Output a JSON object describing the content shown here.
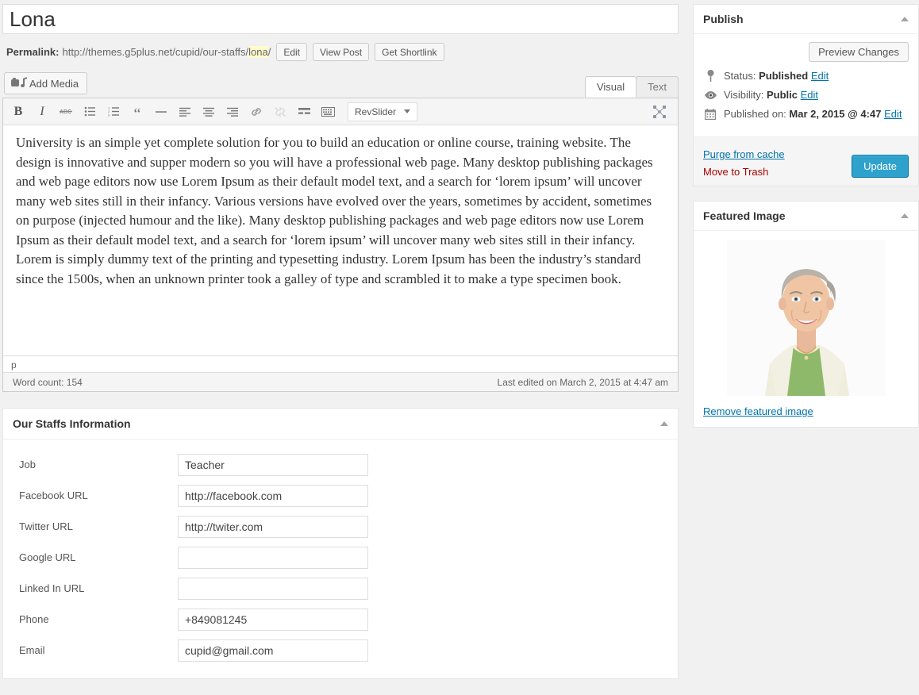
{
  "post": {
    "title": "Lona",
    "title_placeholder": "Enter title here"
  },
  "permalink": {
    "label": "Permalink:",
    "base_url": "http://themes.g5plus.net/cupid/our-staffs/",
    "slug": "lona",
    "trailing": "/",
    "edit_button": "Edit",
    "view_post_button": "View Post",
    "shortlink_button": "Get Shortlink"
  },
  "editor": {
    "add_media_label": "Add Media",
    "tabs": [
      {
        "label": "Visual",
        "active": true
      },
      {
        "label": "Text",
        "active": false
      }
    ],
    "toolbar": [
      {
        "name": "bold-icon",
        "label": "B"
      },
      {
        "name": "italic-icon",
        "label": "I"
      },
      {
        "name": "strikethrough-icon",
        "label": "ABC"
      },
      {
        "name": "bullet-list-icon",
        "label": ""
      },
      {
        "name": "numbered-list-icon",
        "label": ""
      },
      {
        "name": "blockquote-icon",
        "label": "“"
      },
      {
        "name": "horizontal-rule-icon",
        "label": ""
      },
      {
        "name": "align-left-icon",
        "label": ""
      },
      {
        "name": "align-center-icon",
        "label": ""
      },
      {
        "name": "align-right-icon",
        "label": ""
      },
      {
        "name": "insert-link-icon",
        "label": ""
      },
      {
        "name": "unlink-icon",
        "label": ""
      },
      {
        "name": "insert-more-tag-icon",
        "label": ""
      },
      {
        "name": "toolbar-toggle-icon",
        "label": ""
      }
    ],
    "revslider_label": "RevSlider",
    "content": "University is an simple yet complete solution for you to build an education or online course, training website. The design is innovative and supper modern so you will have a professional web page. Many desktop publishing packages and web page editors now use Lorem Ipsum as their default model text, and a search for ‘lorem ipsum’ will uncover many web sites still in their infancy. Various versions have evolved over the years, sometimes by accident, sometimes on purpose (injected humour and the like). Many desktop publishing packages and web page editors now use Lorem Ipsum as their default model text, and a search for ‘lorem ipsum’ will uncover many web sites still in their infancy. Lorem is simply dummy text of the printing and typesetting industry. Lorem Ipsum has been the industry’s standard since the 1500s, when an unknown printer took a galley of type and scrambled it to make a type specimen book.",
    "path": "p",
    "word_count": "Word count: 154",
    "last_edited": "Last edited on March 2, 2015 at 4:47 am"
  },
  "staffs_metabox": {
    "title": "Our Staffs Information",
    "fields": [
      {
        "label": "Job",
        "value": "Teacher",
        "name": "job-field"
      },
      {
        "label": "Facebook URL",
        "value": "http://facebook.com",
        "name": "facebook-url-field"
      },
      {
        "label": "Twitter URL",
        "value": "http://twiter.com",
        "name": "twitter-url-field"
      },
      {
        "label": "Google URL",
        "value": "",
        "name": "google-url-field"
      },
      {
        "label": "Linked In URL",
        "value": "",
        "name": "linkedin-url-field"
      },
      {
        "label": "Phone",
        "value": "+849081245",
        "name": "phone-field"
      },
      {
        "label": "Email",
        "value": "cupid@gmail.com",
        "name": "email-field"
      }
    ]
  },
  "publish_panel": {
    "title": "Publish",
    "preview_button": "Preview Changes",
    "status_label": "Status:",
    "status_value": "Published",
    "status_edit": "Edit",
    "visibility_label": "Visibility:",
    "visibility_value": "Public",
    "visibility_edit": "Edit",
    "published_label": "Published on:",
    "published_value": "Mar 2, 2015 @ 4:47",
    "published_edit": "Edit",
    "purge_link": "Purge from cache",
    "trash_link": "Move to Trash",
    "update_button": "Update"
  },
  "featured_image_panel": {
    "title": "Featured Image",
    "remove_link": "Remove featured image",
    "image_alt": "portrait of smiling older woman with gray hair wearing cream cardigan and green top"
  },
  "colors": {
    "accent": "#2ea2cc",
    "link": "#0073aa",
    "trash": "#aa0000",
    "highlight": "#fffbcc",
    "page_bg": "#f1f1f1"
  }
}
